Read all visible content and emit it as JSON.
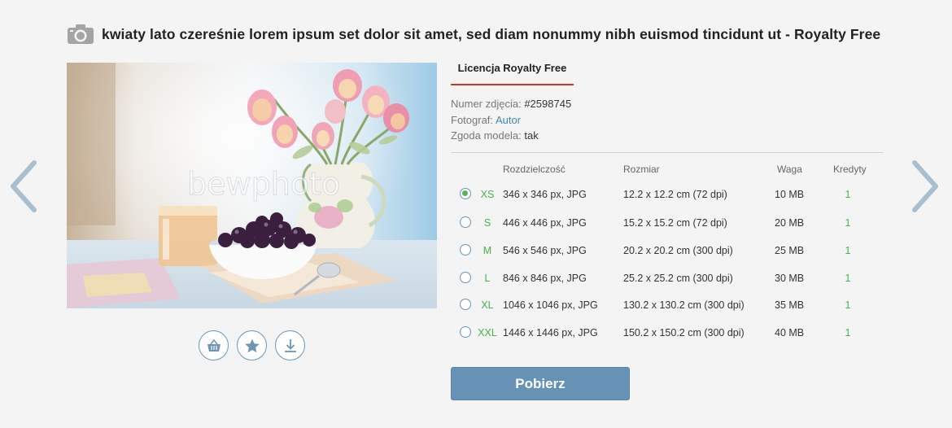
{
  "header": {
    "title": "kwiaty lato czereśnie lorem ipsum set dolor sit amet, sed diam nonummy nibh euismod tincidunt ut - Royalty Free",
    "icon": "camera-icon"
  },
  "photo": {
    "watermark": "bewphoto"
  },
  "actions": [
    {
      "icon": "basket-icon"
    },
    {
      "icon": "star-icon"
    },
    {
      "icon": "download-icon"
    }
  ],
  "license": {
    "tab_label": "Licencja Royalty Free",
    "photo_number_label": "Numer zdjęcia:",
    "photo_number": "#2598745",
    "photographer_label": "Fotograf:",
    "photographer": "Autor",
    "model_release_label": "Zgoda modela:",
    "model_release": "tak"
  },
  "table": {
    "headers": {
      "resolution": "Rozdzielczość",
      "size": "Rozmiar",
      "weight": "Waga",
      "credits": "Kredyty"
    },
    "rows": [
      {
        "size": "XS",
        "resolution": "346 x 346 px, JPG",
        "dimensions": "12.2 x 12.2 cm (72 dpi)",
        "weight": "10 MB",
        "credits": "1",
        "selected": true
      },
      {
        "size": "S",
        "resolution": "446 x 446 px, JPG",
        "dimensions": "15.2 x 15.2 cm (72 dpi)",
        "weight": "20 MB",
        "credits": "1",
        "selected": false
      },
      {
        "size": "M",
        "resolution": "546 x 546 px, JPG",
        "dimensions": "20.2 x 20.2 cm (300 dpi)",
        "weight": "25 MB",
        "credits": "1",
        "selected": false
      },
      {
        "size": "L",
        "resolution": "846 x 846 px, JPG",
        "dimensions": "25.2 x 25.2 cm (300 dpi)",
        "weight": "30 MB",
        "credits": "1",
        "selected": false
      },
      {
        "size": "XL",
        "resolution": "1046 x 1046 px, JPG",
        "dimensions": "130.2 x 130.2 cm (300 dpi)",
        "weight": "35 MB",
        "credits": "1",
        "selected": false
      },
      {
        "size": "XXL",
        "resolution": "1446 x 1446 px, JPG",
        "dimensions": "150.2 x 150.2 cm (300 dpi)",
        "weight": "40 MB",
        "credits": "1",
        "selected": false
      }
    ]
  },
  "download_button": {
    "label": "Pobierz"
  },
  "colors": {
    "accent_blue": "#6892b5",
    "tab_underline": "#d0362c",
    "size_green": "#4caf50",
    "arrow": "#a9bfd0"
  }
}
